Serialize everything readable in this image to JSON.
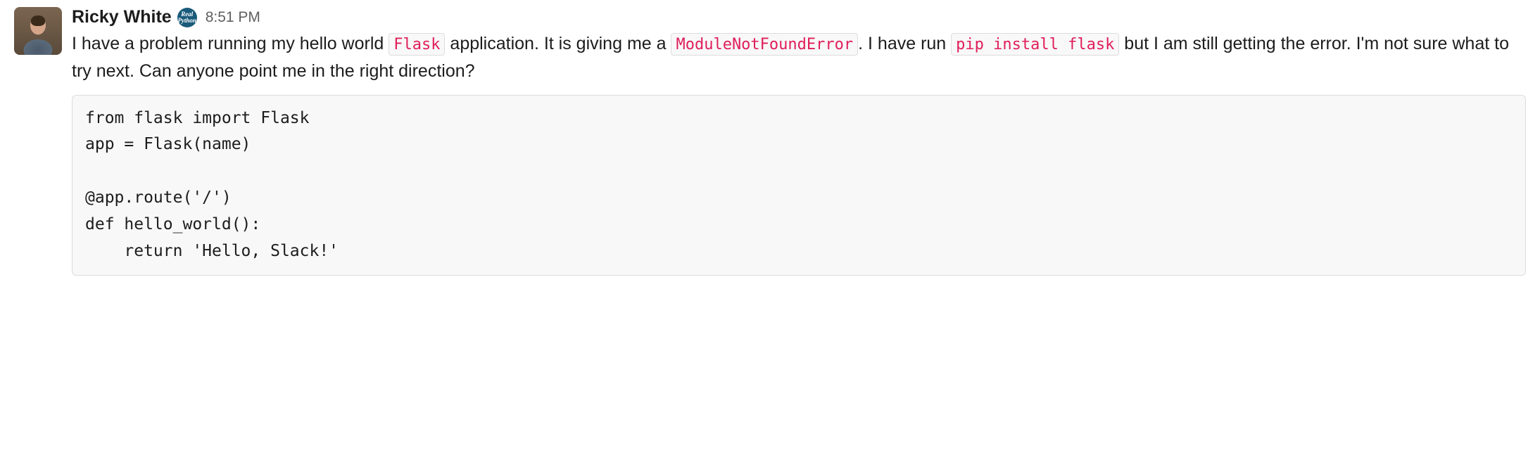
{
  "message": {
    "author": "Ricky White",
    "badge_text": "Real Python",
    "timestamp": "8:51 PM",
    "text": {
      "part1": "I have a problem running my hello world ",
      "code1": "Flask",
      "part2": " application. It is giving me a ",
      "code2": "ModuleNotFoundError",
      "part3": ". I have run ",
      "code3": "pip install flask",
      "part4": " but I am still getting the error. I'm not sure what to try next. Can anyone point me in the right direction?"
    },
    "code_block": "from flask import Flask\napp = Flask(name)\n\n@app.route('/')\ndef hello_world():\n    return 'Hello, Slack!'"
  }
}
